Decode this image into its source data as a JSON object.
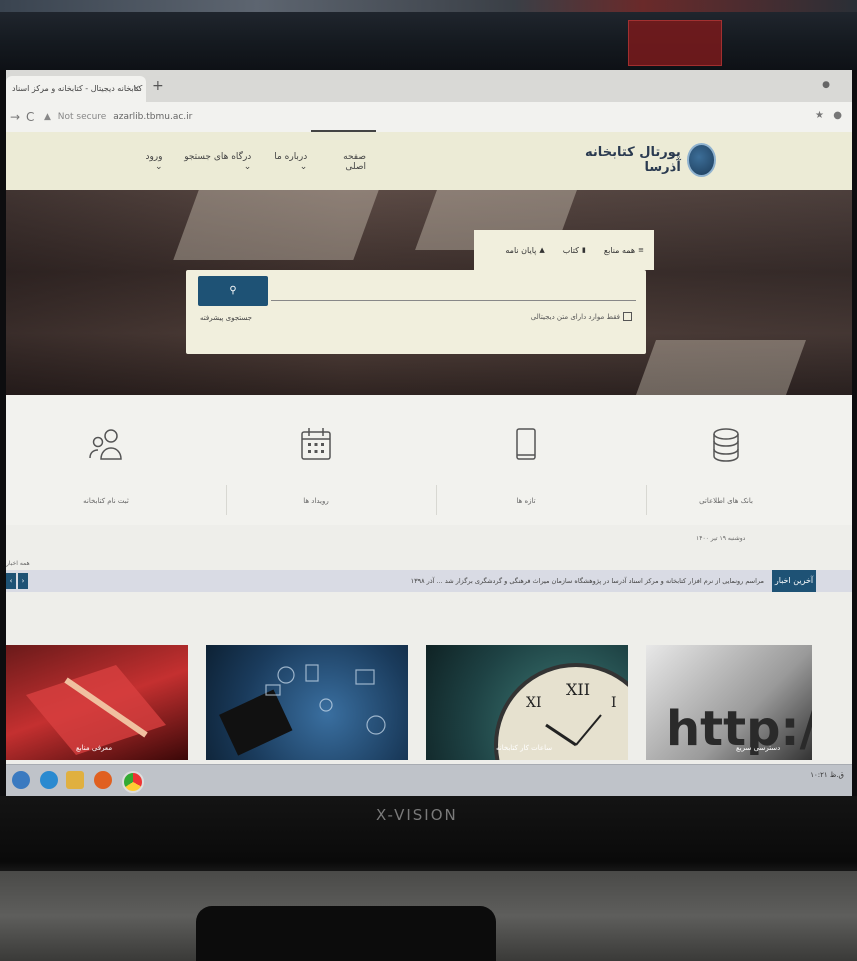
{
  "browser": {
    "tab_title": "کتابخانه دیجیتال - کتابخانه و مرکز اسناد",
    "tab_close": "×",
    "new_tab": "+",
    "url_warning": "Not secure",
    "url": "azarlib.tbmu.ac.ir"
  },
  "site": {
    "logo_text": "پورتال کتابخانه آذرسا",
    "menu": [
      {
        "label": "صفحه اصلی"
      },
      {
        "label": "درباره ما ⌄"
      },
      {
        "label": "درگاه های جستجو ⌄"
      },
      {
        "label": "ورود ⌄"
      }
    ]
  },
  "search": {
    "tabs": [
      {
        "icon": "≡",
        "label": "همه منابع"
      },
      {
        "icon": "▮",
        "label": "کتاب"
      },
      {
        "icon": "▲",
        "label": "پایان نامه"
      }
    ],
    "button_icon": "⚲",
    "advanced_label": "جستجوی پیشرفته",
    "fulltext_label": "فقط موارد دارای متن دیجیتالی"
  },
  "features": [
    {
      "label": "بانک های اطلاعاتی",
      "icon": "database-icon"
    },
    {
      "label": "تازه ها",
      "icon": "book-icon"
    },
    {
      "label": "رویداد ها",
      "icon": "calendar-icon"
    },
    {
      "label": "ثبت نام کتابخانه",
      "icon": "users-icon"
    }
  ],
  "news": {
    "date": "دوشنبه ۱۹ تیر ۱۴۰۰",
    "title": "آخرین اخبار",
    "ticker": "مراسم رونمایی از نرم افزار کتابخانه و مرکز اسناد آذرسا در پژوهشگاه سازمان میراث فرهنگی و گردشگری برگزار شد ... آذر ۱۳۹۸",
    "prev": "‹",
    "next": "›",
    "left_label": "همه اخبار"
  },
  "cards": [
    {
      "caption": "دسترسی سریع"
    },
    {
      "caption": "ساعات کار کتابخانه"
    },
    {
      "caption": ""
    },
    {
      "caption": "معرفی منابع"
    }
  ],
  "taskbar": {
    "clock": "۱۰:۲۱ ق.ظ"
  },
  "monitor": {
    "brand": "X-VISION"
  },
  "colors": {
    "accent": "#1e5275",
    "header_bg": "#ecebd6",
    "search_bg": "#f1efdd"
  }
}
